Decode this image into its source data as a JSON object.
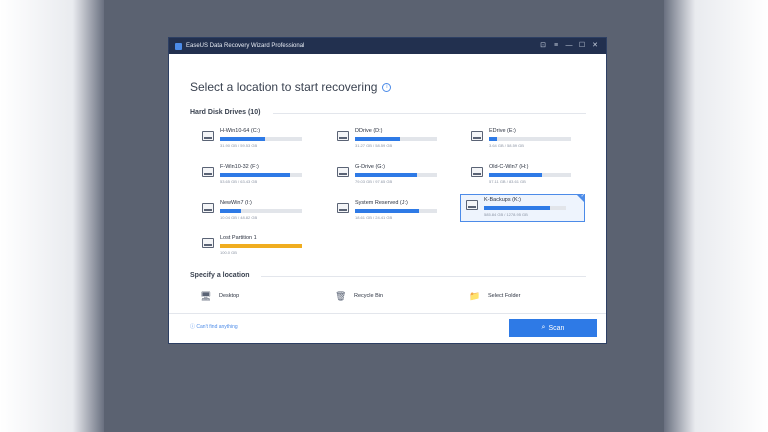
{
  "window": {
    "title": "EaseUS Data Recovery Wizard Professional",
    "controls": [
      "⊡",
      "≡",
      "—",
      "☐",
      "✕"
    ]
  },
  "heading": "Select a location to start recovering",
  "hard_disk": {
    "label": "Hard Disk Drives (10)",
    "drives": [
      {
        "name": "H-Win10-64 (C:)",
        "size": "31.90 GB / 59.53 GB",
        "usage": 0.55,
        "selected": false
      },
      {
        "name": "DDrive (D:)",
        "size": "31.27 GB / 58.59 GB",
        "usage": 0.55,
        "selected": false
      },
      {
        "name": "EDrive (E:)",
        "size": "3.64 GB / 58.59 GB",
        "usage": 0.1,
        "selected": false
      },
      {
        "name": "F-Win10-32 (F:)",
        "size": "53.65 GB / 63.43 GB",
        "usage": 0.85,
        "selected": false
      },
      {
        "name": "G-Drive (G:)",
        "size": "79.03 GB / 97.65 GB",
        "usage": 0.75,
        "selected": false
      },
      {
        "name": "Old-C-Win7 (H:)",
        "size": "57.11 GB / 83.61 GB",
        "usage": 0.65,
        "selected": false
      },
      {
        "name": "NewWin7 (I:)",
        "size": "10.04 GB / 48.82 GB",
        "usage": 0.25,
        "selected": false
      },
      {
        "name": "System Reserved (J:)",
        "size": "18.61 GB / 24.41 GB",
        "usage": 0.78,
        "selected": false
      },
      {
        "name": "K-Backups (K:)",
        "size": "585.84 GB / 1278.95 GB",
        "usage": 0.8,
        "selected": true
      },
      {
        "name": "Lost Partition 1",
        "size": "100.0 GB",
        "usage": 1.0,
        "selected": false,
        "bar_color": "orange"
      }
    ]
  },
  "specify": {
    "label": "Specify a location",
    "items": [
      {
        "name": "Desktop",
        "icon": "desktop-icon"
      },
      {
        "name": "Recycle Bin",
        "icon": "recycle-bin-icon"
      },
      {
        "name": "Select Folder",
        "icon": "folder-icon"
      }
    ]
  },
  "footer": {
    "help": "Can't find anything",
    "scan_label": "Scan"
  },
  "colors": {
    "accent": "#2e7ae6",
    "titlebar": "#22304f",
    "lost_partition": "#f0ad1f"
  }
}
